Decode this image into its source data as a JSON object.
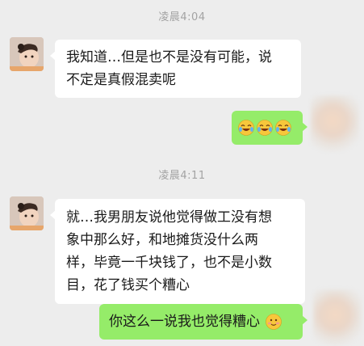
{
  "chat": {
    "timestamps": [
      "凌晨4:04",
      "凌晨4:11"
    ],
    "messages": [
      {
        "side": "in",
        "text": "我知道…但是也不是没有可能，说不定是真假混卖呢",
        "lines": [
          "我知道…但是也不是没有可能，说",
          "不定是真假混卖呢"
        ]
      },
      {
        "side": "out",
        "emojis": [
          "crying-laughing-emoji",
          "crying-laughing-emoji",
          "crying-laughing-emoji"
        ]
      },
      {
        "side": "in",
        "text": "就…我男朋友说他觉得做工没有想象中那么好，和地摊货没什么两样，毕竟一千块钱了，也不是小数目，花了钱买个糟心",
        "lines": [
          "就…我男朋友说他觉得做工没有想",
          "象中那么好，和地摊货没什么两",
          "样，毕竟一千块钱了，也不是小数",
          "目，花了钱买个糟心"
        ]
      },
      {
        "side": "out",
        "text": "你这么一说我也觉得糟心",
        "emoji": "flushed-smile-emoji"
      }
    ]
  },
  "colors": {
    "background": "#ededed",
    "incoming_bubble": "#ffffff",
    "outgoing_bubble": "#95ec69",
    "timestamp_text": "#a3a3a3"
  }
}
